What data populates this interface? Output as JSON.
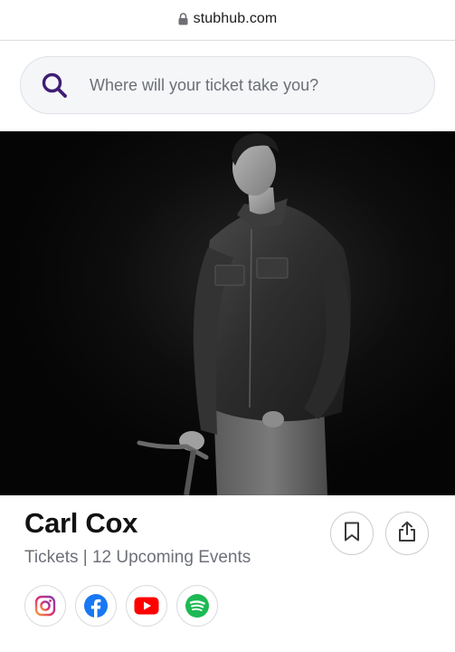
{
  "browser": {
    "url": "stubhub.com"
  },
  "search": {
    "placeholder": "Where will your ticket take you?"
  },
  "hero": {
    "image_description_icon": "performer-photo"
  },
  "performer": {
    "name": "Carl Cox",
    "subtitle": "Tickets | 12 Upcoming Events"
  },
  "actions": {
    "save_icon": "bookmark-icon",
    "share_icon": "share-icon"
  },
  "social": [
    {
      "icon": "instagram-icon",
      "color": "#c13584"
    },
    {
      "icon": "facebook-icon",
      "color": "#1877f2"
    },
    {
      "icon": "youtube-icon",
      "color": "#ff0000"
    },
    {
      "icon": "spotify-icon",
      "color": "#1db954"
    }
  ],
  "colors": {
    "brand_purple": "#3f1d74",
    "text_primary": "#121212",
    "text_secondary": "#6d7078"
  }
}
